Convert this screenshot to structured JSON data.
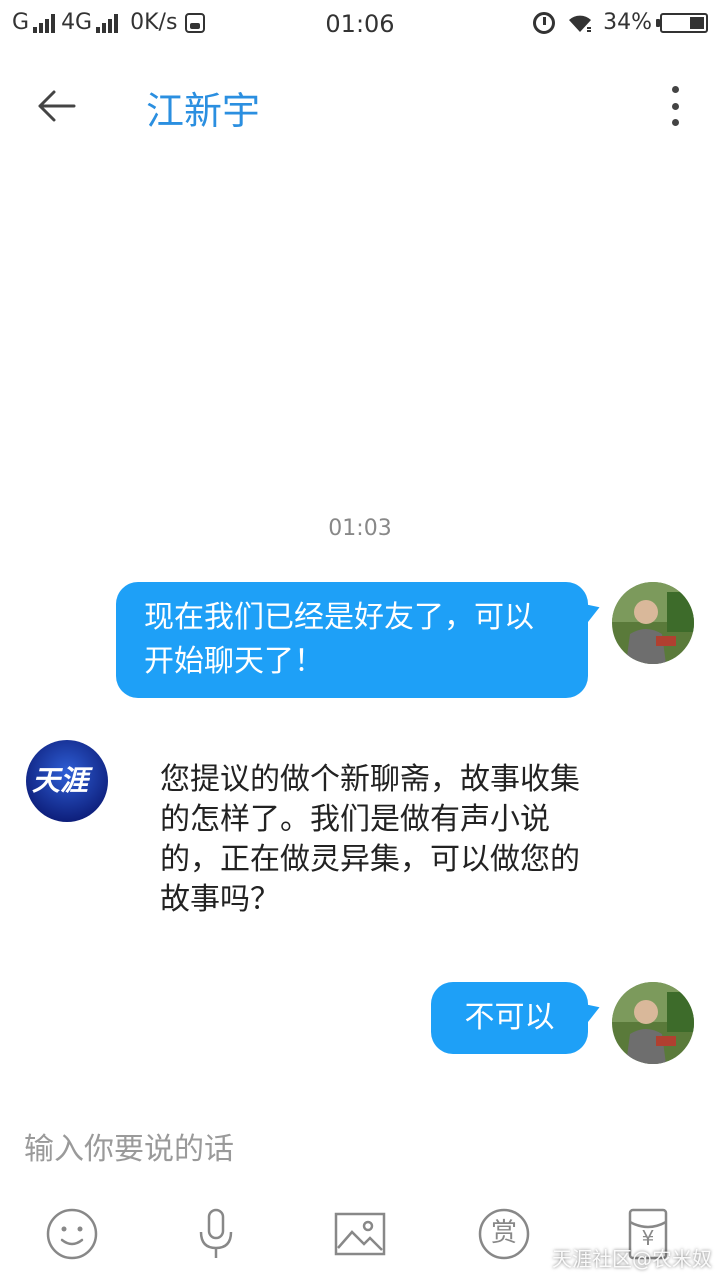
{
  "status_bar": {
    "carrier1": "G",
    "carrier2": "4G",
    "speed": "0K/s",
    "time": "01:06",
    "battery": "34%",
    "battery_level": 0.34,
    "icons": [
      "signal-icon",
      "sim-icon",
      "alarm-icon",
      "wifi-icon",
      "battery-icon"
    ]
  },
  "header": {
    "title": "江新宇",
    "back_icon": "back-arrow-icon",
    "more_icon": "more-vertical-icon"
  },
  "chat": {
    "timestamp": "01:03",
    "messages": [
      {
        "from": "me",
        "text": "现在我们已经是好友了，可以开始聊天了！"
      },
      {
        "from": "them",
        "text": "您提议的做个新聊斋，故事收集的怎样了。我们是做有声小说的，正在做灵异集，可以做您的故事吗？"
      },
      {
        "from": "me",
        "text": "不可以"
      }
    ],
    "them_avatar_text": "天涯"
  },
  "composer": {
    "placeholder": "输入你要说的话",
    "tools": [
      "emoji-icon",
      "microphone-icon",
      "image-icon",
      "reward-icon",
      "red-packet-icon"
    ],
    "reward_label": "赏",
    "red_packet_label": "¥"
  },
  "watermark": "天涯社区@农米奴",
  "colors": {
    "accent": "#2b8fe0",
    "bubble": "#1ea0f7"
  }
}
